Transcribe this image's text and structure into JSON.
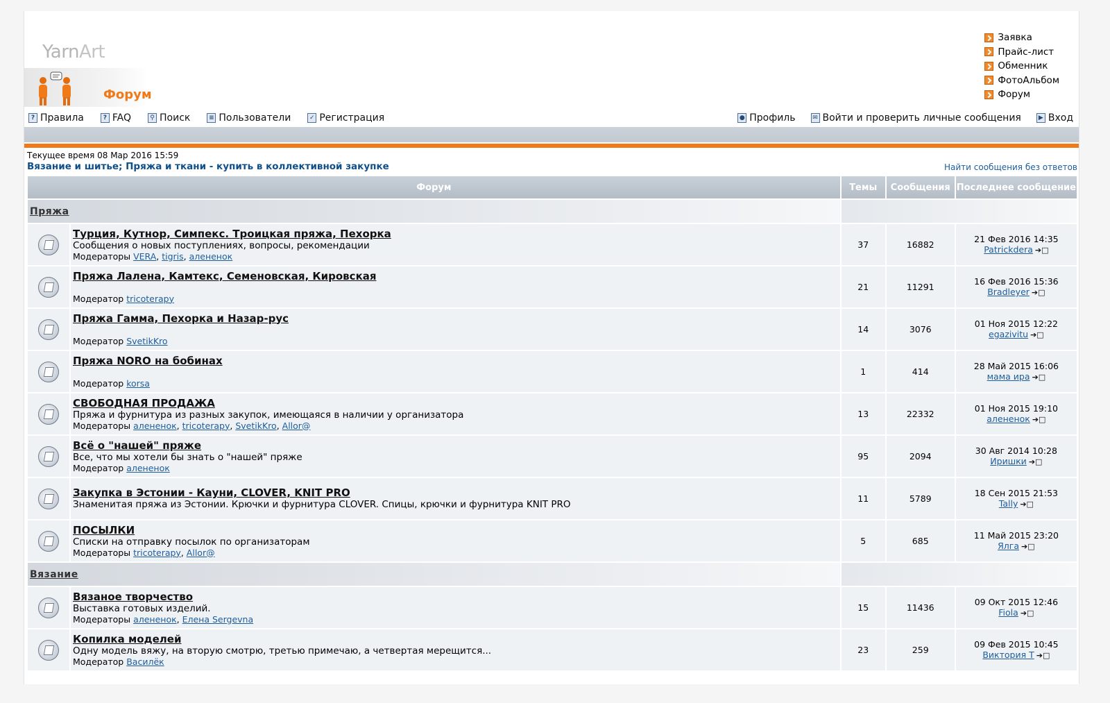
{
  "logo": {
    "part1": "Yarn",
    "part2": "Art",
    "forum_label": "Форум"
  },
  "quick_links": [
    "Заявка",
    "Прайс-лист",
    "Обменник",
    "ФотоАльбом",
    "Форум"
  ],
  "nav_left": [
    "Правила",
    "FAQ",
    "Поиск",
    "Пользователи",
    "Регистрация"
  ],
  "nav_right": [
    "Профиль",
    "Войти и проверить личные сообщения",
    "Вход"
  ],
  "current_time": "Текущее время 08 Мар 2016 15:59",
  "breadcrumb": "Вязание и шитье; Пряжа и ткани - купить в коллективной закупке",
  "unanswered_link": "Найти сообщения без ответов",
  "table_headers": {
    "forum": "Форум",
    "topics": "Темы",
    "posts": "Сообщения",
    "last": "Последнее сообщение"
  },
  "categories": [
    {
      "name": "Пряжа",
      "forums": [
        {
          "title": "Турция, Кутнор, Симпекс. Троицкая пряжа, Пехорка",
          "desc": "Сообщения о новых поступлениях, вопросы, рекомендации",
          "mod_label": "Модераторы",
          "mods": [
            "VERA",
            "tigris",
            "алененок"
          ],
          "topics": "37",
          "posts": "16882",
          "last_date": "21 Фев 2016 14:35",
          "last_user": "Patrickdera"
        },
        {
          "title": "Пряжа Лалена, Камтекс, Семеновская, Кировская",
          "desc": "",
          "mod_label": "Модератор",
          "mods": [
            "tricoterapy"
          ],
          "topics": "21",
          "posts": "11291",
          "last_date": "16 Фев 2016 15:36",
          "last_user": "Bradleyer"
        },
        {
          "title": "Пряжа Гамма, Пехорка и Назар-рус",
          "desc": "",
          "mod_label": "Модератор",
          "mods": [
            "SvetikKro"
          ],
          "topics": "14",
          "posts": "3076",
          "last_date": "01 Ноя 2015 12:22",
          "last_user": "egazivitu"
        },
        {
          "title": "Пряжа NORO на бобинах",
          "desc": "",
          "mod_label": "Модератор",
          "mods": [
            "korsa"
          ],
          "topics": "1",
          "posts": "414",
          "last_date": "28 Май 2015 16:06",
          "last_user": "мама ира"
        },
        {
          "title": "СВОБОДНАЯ ПРОДАЖА",
          "desc": "Пряжа и фурнитура из разных закупок, имеющаяся в наличии у организатора",
          "mod_label": "Модераторы",
          "mods": [
            "алененок",
            "tricoterapy",
            "SvetikKro",
            "Allor@"
          ],
          "topics": "13",
          "posts": "22332",
          "last_date": "01 Ноя 2015 19:10",
          "last_user": "алененок"
        },
        {
          "title": "Всё о \"нашей\" пряже",
          "desc": "Все, что мы хотели бы знать о \"нашей\" пряже",
          "mod_label": "Модератор",
          "mods": [
            "алененок"
          ],
          "topics": "95",
          "posts": "2094",
          "last_date": "30 Авг 2014 10:28",
          "last_user": "Иришки"
        },
        {
          "title": "Закупка в Эстонии - Кауни, CLOVER, KNIT PRO",
          "desc": "Знаменитая пряжа из Эстонии. Крючки и фурнитура CLOVER. Спицы, крючки и фурнитура KNIT PRO",
          "mod_label": "",
          "mods": [],
          "topics": "11",
          "posts": "5789",
          "last_date": "18 Сен 2015 21:53",
          "last_user": "Tally"
        },
        {
          "title": "ПОСЫЛКИ",
          "desc": "Списки на отправку посылок по организаторам",
          "mod_label": "Модераторы",
          "mods": [
            "tricoterapy",
            "Allor@"
          ],
          "topics": "5",
          "posts": "685",
          "last_date": "11 Май 2015 23:20",
          "last_user": "Ялга"
        }
      ]
    },
    {
      "name": "Вязание",
      "forums": [
        {
          "title": "Вязаное творчество",
          "desc": "Выставка готовых изделий.",
          "mod_label": "Модераторы",
          "mods": [
            "алененок",
            "Елена Sergevna"
          ],
          "topics": "15",
          "posts": "11436",
          "last_date": "09 Окт 2015 12:46",
          "last_user": "Fiola"
        },
        {
          "title": "Копилка моделей",
          "desc": "Одну модель вяжу, на вторую смотрю, третью примечаю, а четвертая мерещится...",
          "mod_label": "Модератор",
          "mods": [
            "Василёк"
          ],
          "topics": "23",
          "posts": "259",
          "last_date": "09 Фев 2015 10:45",
          "last_user": "Виктория Т"
        }
      ]
    }
  ]
}
